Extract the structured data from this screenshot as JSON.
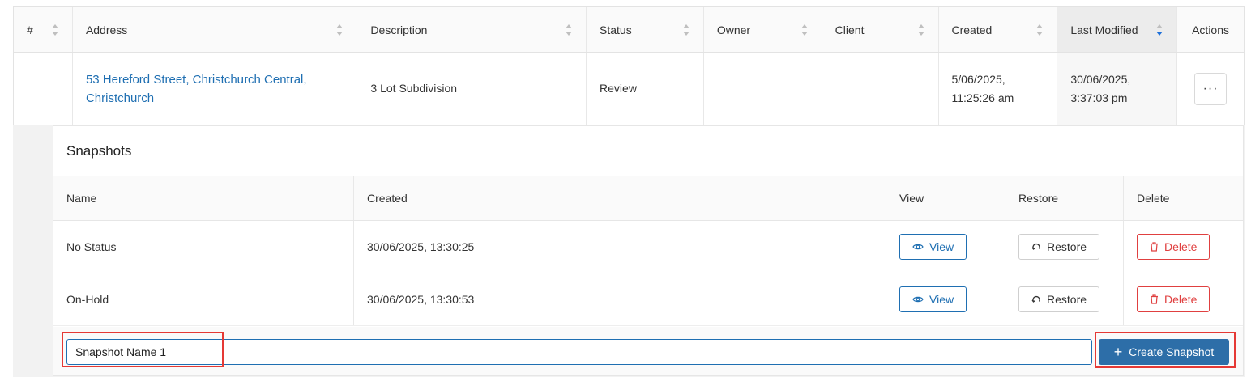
{
  "table": {
    "columns": [
      "#",
      "Address",
      "Description",
      "Status",
      "Owner",
      "Client",
      "Created",
      "Last Modified",
      "Actions"
    ],
    "row": {
      "number": "",
      "address_line1": "53 Hereford Street, Christchurch Central,",
      "address_line2": "Christchurch",
      "description": "3 Lot Subdivision",
      "status": "Review",
      "owner": "",
      "client": "",
      "created_date": "5/06/2025,",
      "created_time": "11:25:26 am",
      "modified_date": "30/06/2025,",
      "modified_time": "3:37:03 pm",
      "actions_label": "···"
    },
    "sorted_column": "Last Modified",
    "sort_direction": "descending"
  },
  "snapshots": {
    "title": "Snapshots",
    "columns": [
      "Name",
      "Created",
      "View",
      "Restore",
      "Delete"
    ],
    "rows": [
      {
        "name": "No Status",
        "created": "30/06/2025, 13:30:25",
        "view_label": "View",
        "restore_label": "Restore",
        "delete_label": "Delete"
      },
      {
        "name": "On-Hold",
        "created": "30/06/2025, 13:30:53",
        "view_label": "View",
        "restore_label": "Restore",
        "delete_label": "Delete"
      }
    ],
    "input_value": "Snapshot Name 1",
    "create_label": "Create Snapshot"
  },
  "colors": {
    "link": "#1f6fb2",
    "primary_button": "#2d6ea8",
    "delete": "#e04040",
    "highlight": "#e53935",
    "sort_active": "#1e6fd9"
  }
}
